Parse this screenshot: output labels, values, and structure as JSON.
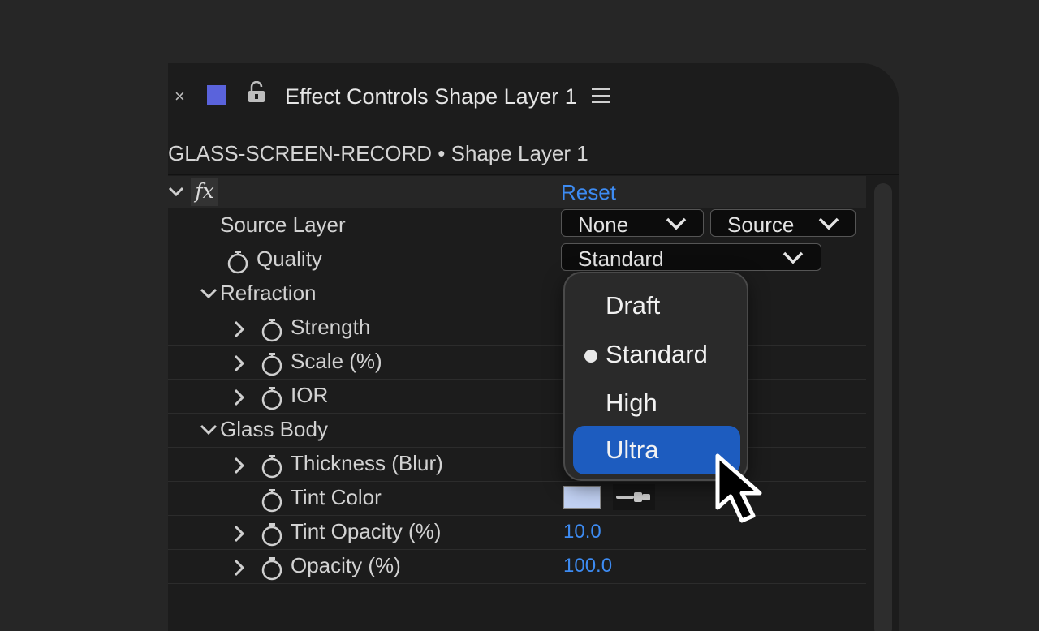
{
  "panel": {
    "close_glyph": "×",
    "title": "Effect Controls Shape Layer 1",
    "swatch_color": "#5a63dc",
    "breadcrumb": "GLASS-SCREEN-RECORD • Shape Layer 1"
  },
  "effect": {
    "fx_glyph": "fx",
    "reset_label": "Reset"
  },
  "properties": {
    "source_layer": {
      "label": "Source Layer",
      "select_1": "None",
      "select_2": "Source"
    },
    "quality": {
      "label": "Quality",
      "selected": "Standard"
    },
    "refraction": {
      "label": "Refraction"
    },
    "strength": {
      "label": "Strength"
    },
    "scale": {
      "label": "Scale (%)"
    },
    "ior": {
      "label": "IOR"
    },
    "glass_body": {
      "label": "Glass Body"
    },
    "thickness": {
      "label": "Thickness (Blur)"
    },
    "tint_color": {
      "label": "Tint Color",
      "color": "#c2d2f4"
    },
    "tint_opacity": {
      "label": "Tint Opacity (%)",
      "value": "10.0"
    },
    "opacity": {
      "label": "Opacity (%)",
      "value": "100.0"
    }
  },
  "quality_menu": {
    "options": [
      "Draft",
      "Standard",
      "High",
      "Ultra"
    ],
    "checked": "Standard",
    "highlighted": "Ultra"
  },
  "colors": {
    "accent": "#3d8bf2",
    "highlight": "#1d5cbf",
    "background": "#262626"
  }
}
